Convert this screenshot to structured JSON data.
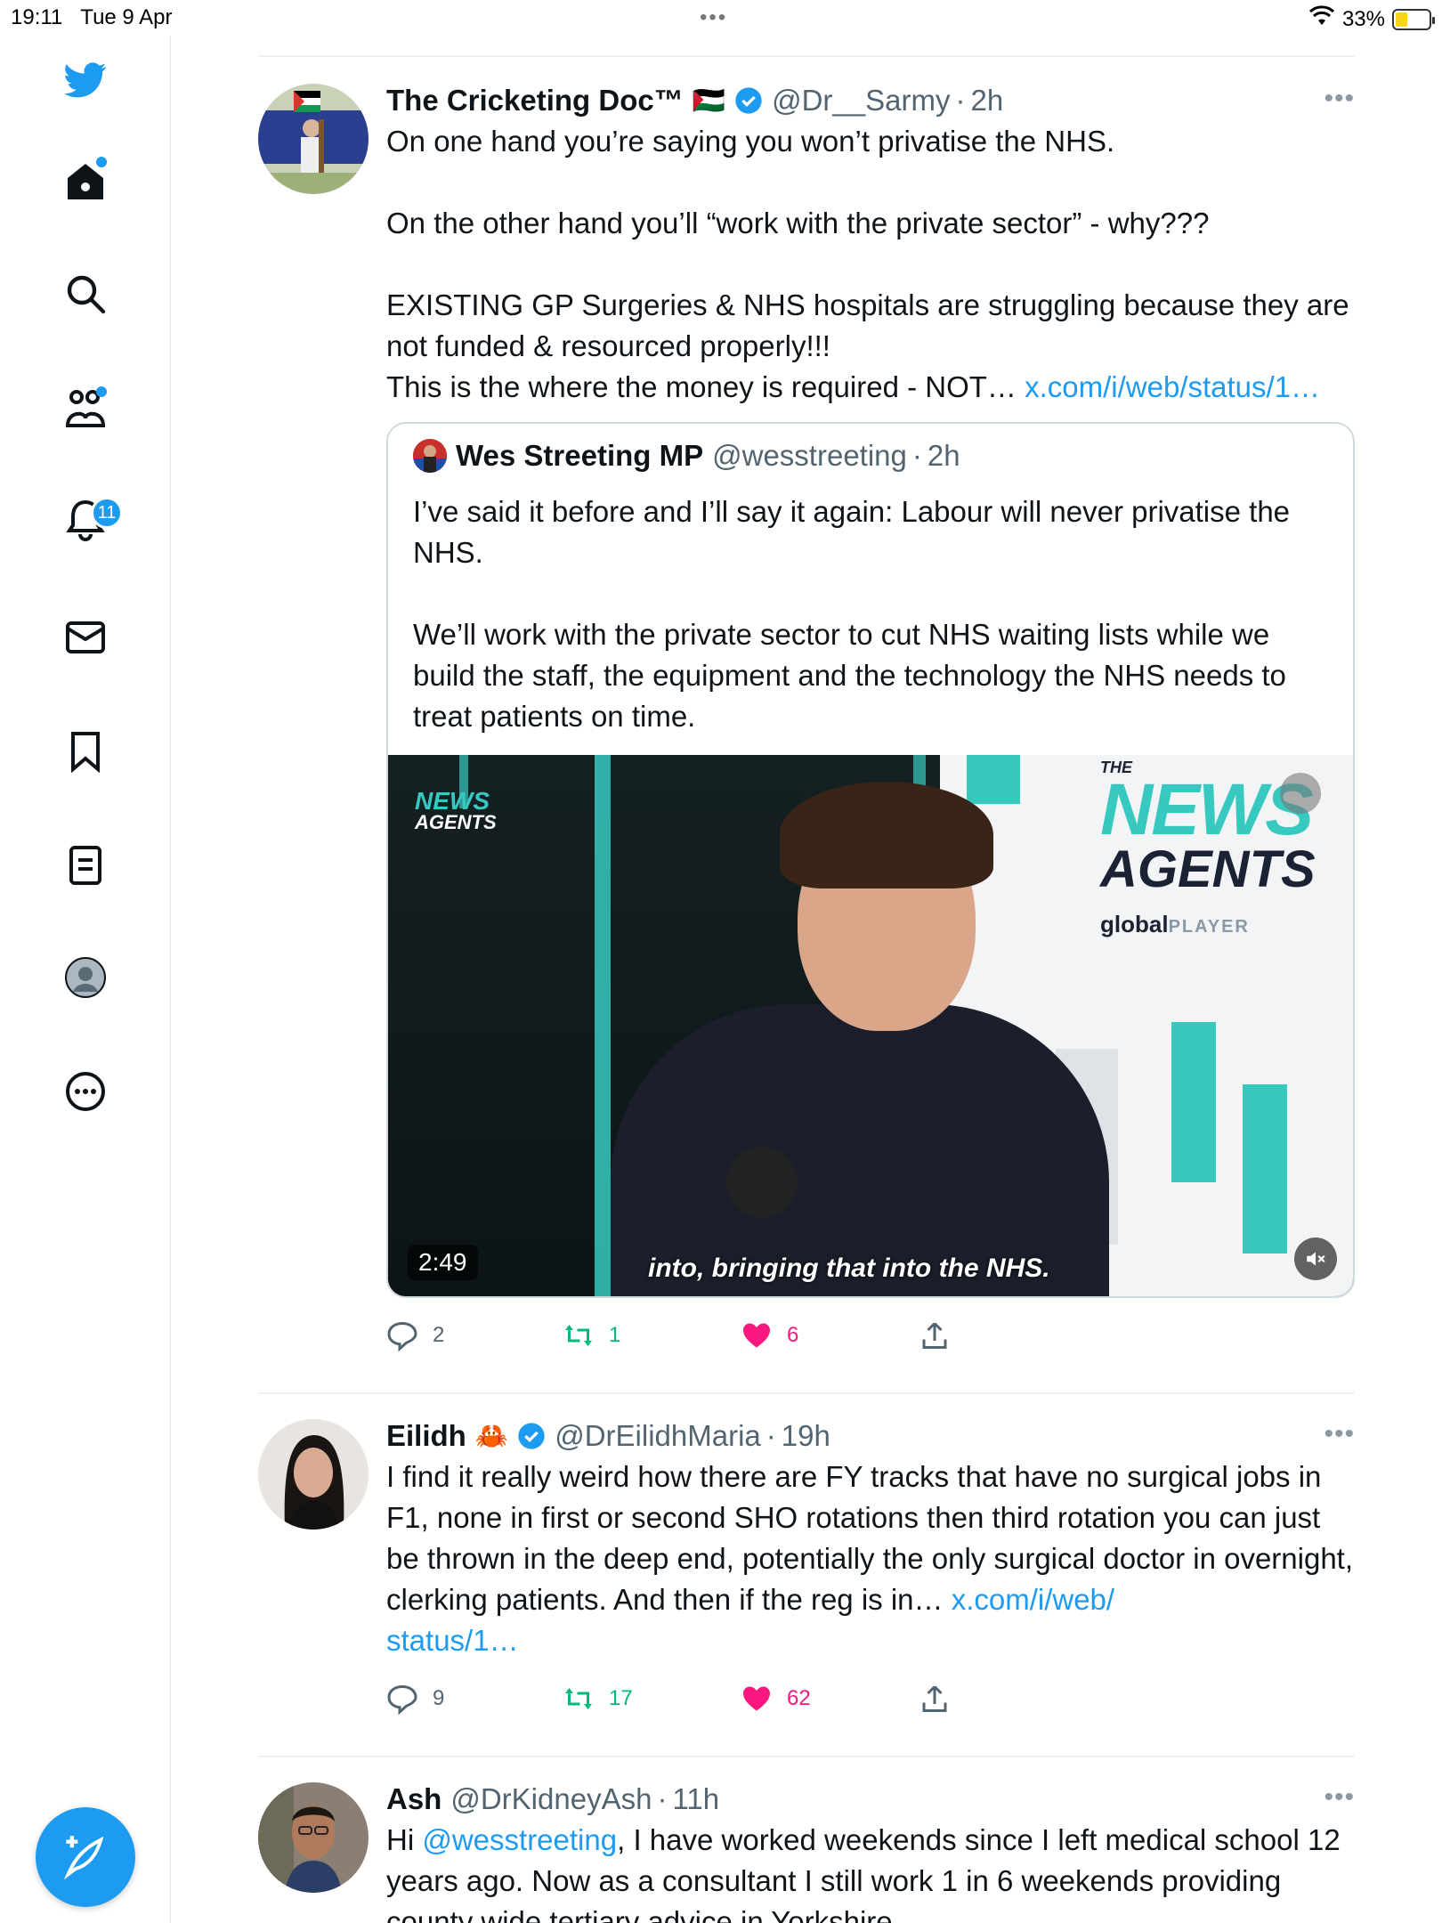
{
  "status_bar": {
    "time": "19:11",
    "date": "Tue 9 Apr",
    "battery": "33%",
    "battery_level": 0.33,
    "dots": "•••"
  },
  "sidebar": {
    "notification_count": "11",
    "items": [
      "home-icon",
      "search-icon",
      "communities-icon",
      "notifications-icon",
      "messages-icon",
      "bookmarks-icon",
      "lists-icon",
      "profile-icon",
      "more-icon"
    ]
  },
  "tweets": [
    {
      "name": "The Cricketing Doc™",
      "emoji": "🇵🇸",
      "handle": "@Dr__Sarmy",
      "sep": "·",
      "time": "2h",
      "text": "On one hand you’re saying you won’t privatise the NHS.\n\nOn the other hand you’ll “work with the private sector” - why???\n\nEXISTING GP Surgeries & NHS hospitals are struggling because they are not funded & resourced properly!!!\nThis is the where the money is required - NOT… ",
      "link": "x.com/i/web/status/1…",
      "quote": {
        "name": "Wes Streeting MP",
        "handle": "@wesstreeting",
        "sep": "·",
        "time": "2h",
        "text": "I’ve said it before and I’ll say it again: Labour will never privatise the NHS.\n\nWe’ll work with the private sector to cut NHS waiting lists while we build the staff, the equipment and the technology the NHS needs to treat patients on time.",
        "video": {
          "logo_small_1": "NEWS",
          "logo_small_2": "AGENTS",
          "logo_the": "THE",
          "logo_news": "NEWS",
          "logo_agents": "AGENTS",
          "global": "global",
          "player": "PLAYER",
          "duration": "2:49",
          "caption": "into, bringing that into the NHS."
        }
      },
      "replies": "2",
      "retweets": "1",
      "likes": "6"
    },
    {
      "name": "Eilidh",
      "emoji": "🦀",
      "handle": "@DrEilidhMaria",
      "sep": "·",
      "time": "19h",
      "text": "I find it really weird how there are FY tracks that have no surgical jobs in F1, none in first or second SHO rotations then third rotation you can just be thrown in the deep end, potentially the only surgical doctor in overnight, clerking patients. And then if the reg is in… ",
      "link": "x.com/i/web/\nstatus/1…",
      "replies": "9",
      "retweets": "17",
      "likes": "62"
    },
    {
      "name": "Ash",
      "handle": "@DrKidneyAsh",
      "sep": "·",
      "time": "11h",
      "text_pre": "Hi ",
      "mention": "@wesstreeting",
      "text_post": ", I have worked weekends since I left medical school 12 years ago. Now as a consultant I still work 1 in 6 weekends providing county wide tertiary advice in Yorkshire."
    }
  ],
  "colors": {
    "accent": "#1d9bf0",
    "like": "#f91880",
    "retweet": "#00ba7c",
    "secondary_text": "#536471"
  }
}
